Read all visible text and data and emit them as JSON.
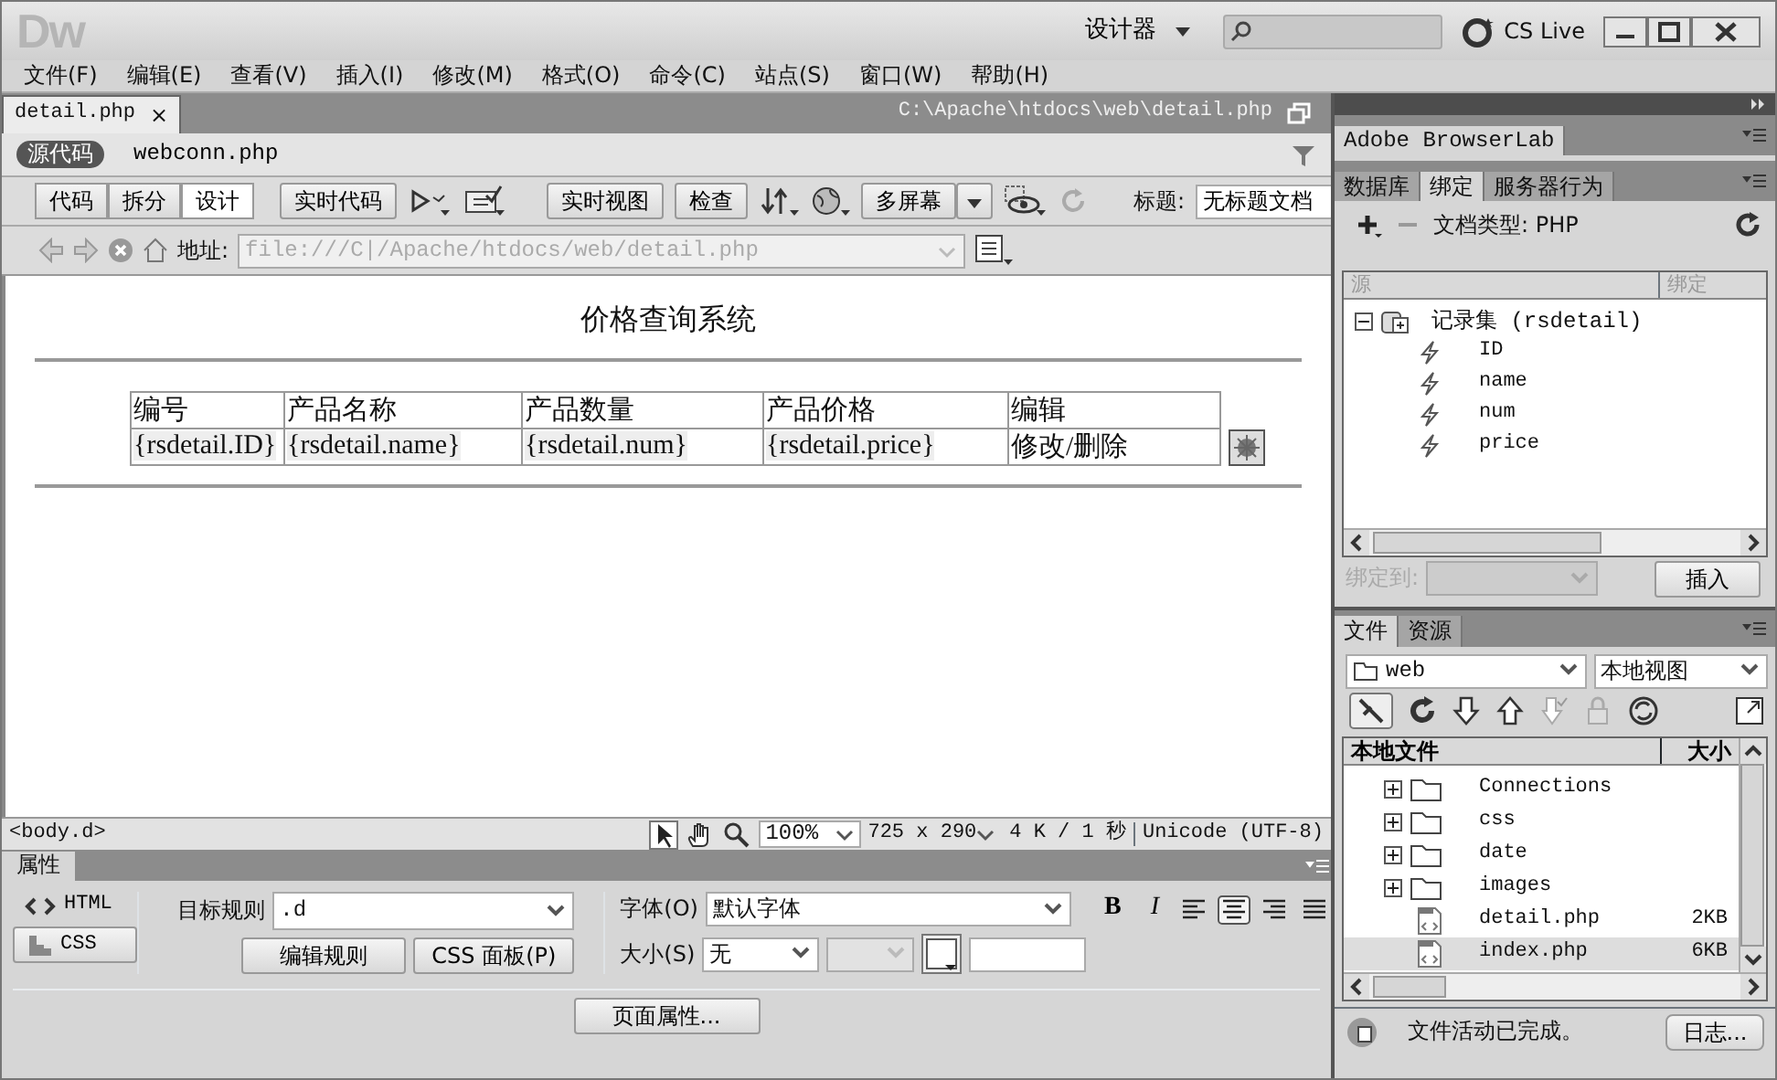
{
  "app_logo": "Dw",
  "title_bar": {
    "workspace": "设计器",
    "cs_live": "CS Live"
  },
  "menu": [
    "文件(F)",
    "编辑(E)",
    "查看(V)",
    "插入(I)",
    "修改(M)",
    "格式(O)",
    "命令(C)",
    "站点(S)",
    "窗口(W)",
    "帮助(H)"
  ],
  "document_tab": {
    "label": "detail.php",
    "close": "×",
    "selected": true
  },
  "file_path": "C:\\Apache\\htdocs\\web\\detail.php",
  "related_files": [
    {
      "label": "源代码",
      "selected": true
    },
    {
      "label": "webconn.php",
      "selected": false
    }
  ],
  "toolbar": {
    "views": [
      {
        "label": "代码",
        "selected": false
      },
      {
        "label": "拆分",
        "selected": false
      },
      {
        "label": "设计",
        "selected": true
      }
    ],
    "live_code": "实时代码",
    "live_view": "实时视图",
    "inspect": "检查",
    "multiscreen": "多屏幕",
    "title_label": "标题:",
    "title_value": "无标题文档"
  },
  "address": {
    "label": "地址:",
    "value": "file:///C|/Apache/htdocs/web/detail.php"
  },
  "page": {
    "heading": "价格查询系统",
    "table": {
      "columns": [
        "编号",
        "产品名称",
        "产品数量",
        "产品价格",
        "编辑"
      ],
      "rows": [
        [
          "{rsdetail.ID}",
          "{rsdetail.name}",
          "{rsdetail.num}",
          "{rsdetail.price}",
          "修改/删除"
        ]
      ]
    }
  },
  "status_bar": {
    "tag": "<body.d>",
    "zoom": "100%",
    "size": "725 x 290",
    "download": "4 K / 1 秒",
    "encoding": "Unicode (UTF-8)"
  },
  "properties": {
    "title": "属性",
    "modes": [
      {
        "label": "HTML",
        "selected": false
      },
      {
        "label": "CSS",
        "selected": true
      }
    ],
    "target_rule_label": "目标规则",
    "target_rule": ".d",
    "edit_rule": "编辑规则",
    "css_panel": "CSS 面板(P)",
    "font_label": "字体(O)",
    "font": "默认字体",
    "bold": "B",
    "italic": "I",
    "alignment": [
      {
        "kind": "left",
        "selected": false
      },
      {
        "kind": "center",
        "selected": true
      },
      {
        "kind": "right",
        "selected": false
      },
      {
        "kind": "justify",
        "selected": false
      }
    ],
    "size_label": "大小(S)",
    "size": "无",
    "page_properties": "页面属性..."
  },
  "browserlab": "Adobe BrowserLab",
  "panel_tabs": [
    {
      "label": "数据库",
      "selected": false
    },
    {
      "label": "绑定",
      "selected": true
    },
    {
      "label": "服务器行为",
      "selected": false
    }
  ],
  "doc_type": "文档类型: PHP",
  "bindings": {
    "columns": [
      "源",
      "绑定"
    ],
    "tree": [
      {
        "label": "记录集 (rsdetail)",
        "expanded": true,
        "children": [
          {
            "label": "ID"
          },
          {
            "label": "name"
          },
          {
            "label": "num"
          },
          {
            "label": "price"
          }
        ]
      }
    ],
    "bind_to_label": "绑定到:",
    "insert": "插入"
  },
  "files_tabs": [
    {
      "label": "文件",
      "selected": true
    },
    {
      "label": "资源",
      "selected": false
    }
  ],
  "site": "web",
  "view": "本地视图",
  "files": {
    "columns": [
      "本地文件",
      "大小"
    ],
    "items": [
      {
        "name": "Connections",
        "kind": "folder",
        "selected": false
      },
      {
        "name": "css",
        "kind": "folder",
        "selected": false
      },
      {
        "name": "date",
        "kind": "folder",
        "selected": false
      },
      {
        "name": "images",
        "kind": "folder",
        "selected": false
      },
      {
        "name": "detail.php",
        "kind": "file",
        "size": "2KB",
        "selected": false
      },
      {
        "name": "index.php",
        "kind": "file",
        "size": "6KB",
        "selected": true
      }
    ]
  },
  "status": "文件活动已完成。",
  "log": "日志..."
}
